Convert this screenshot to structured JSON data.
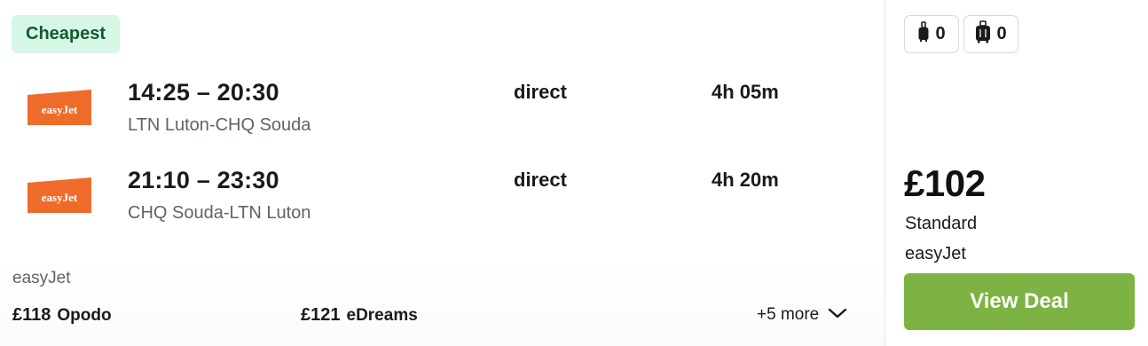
{
  "badge": "Cheapest",
  "legs": [
    {
      "airline_logo": "easyJet",
      "times": "14:25 – 20:30",
      "route": "LTN Luton-CHQ Souda",
      "stops": "direct",
      "duration": "4h 05m"
    },
    {
      "airline_logo": "easyJet",
      "times": "21:10 – 23:30",
      "route": "CHQ Souda-LTN Luton",
      "stops": "direct",
      "duration": "4h 20m"
    }
  ],
  "footer": {
    "airline": "easyJet",
    "alternatives": [
      {
        "price": "£118",
        "site": "Opodo"
      },
      {
        "price": "£121",
        "site": "eDreams"
      }
    ],
    "more": "+5 more"
  },
  "bags": {
    "personal": {
      "icon": "personal-bag-icon",
      "count": "0"
    },
    "carry_on": {
      "icon": "carry-on-bag-icon",
      "count": "0"
    }
  },
  "deal": {
    "price": "£102",
    "fare": "Standard",
    "seller": "easyJet",
    "button": "View Deal"
  },
  "colors": {
    "badge_bg": "#d6f7e5",
    "badge_text": "#145a32",
    "logo_orange": "#ef6b2a",
    "button_green": "#7cb342"
  }
}
